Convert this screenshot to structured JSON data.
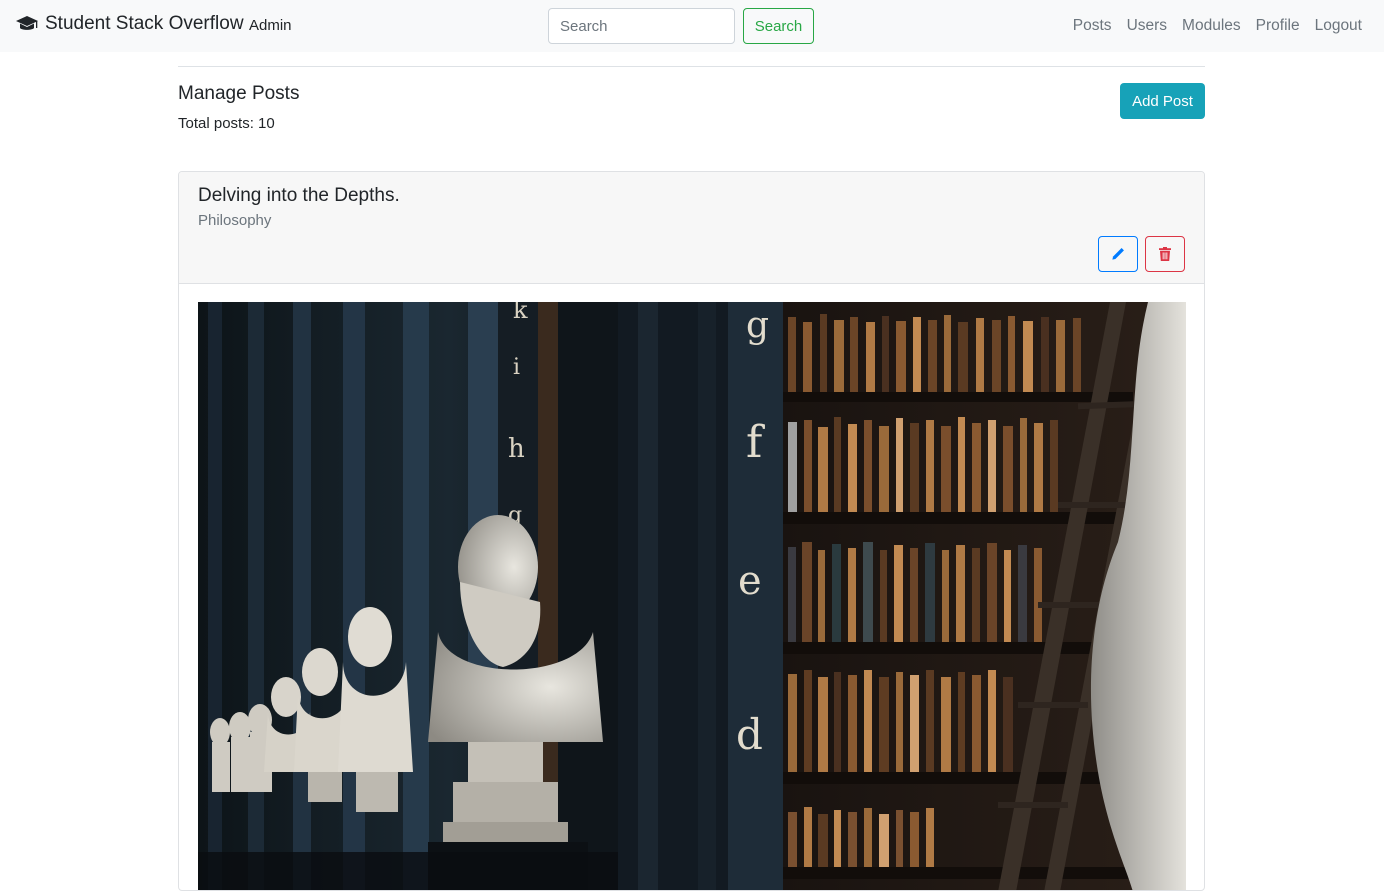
{
  "navbar": {
    "brand": "Student Stack Overflow",
    "brand_icon": "graduation-cap-icon",
    "role": "Admin",
    "search_placeholder": "Search",
    "search_button": "Search",
    "links": [
      "Posts",
      "Users",
      "Modules",
      "Profile",
      "Logout"
    ]
  },
  "page": {
    "title": "Manage Posts",
    "total": "Total posts: 10",
    "add_button": "Add Post"
  },
  "post": {
    "title": "Delving into the Depths.",
    "module": "Philosophy",
    "edit_icon": "pencil-icon",
    "delete_icon": "trash-icon",
    "image": "library-busts-photo"
  },
  "colors": {
    "navbar_bg": "#f8f9fa",
    "search_green": "#28a745",
    "add_teal": "#17a2b8",
    "edit_blue": "#007bff",
    "delete_red": "#dc3545"
  }
}
